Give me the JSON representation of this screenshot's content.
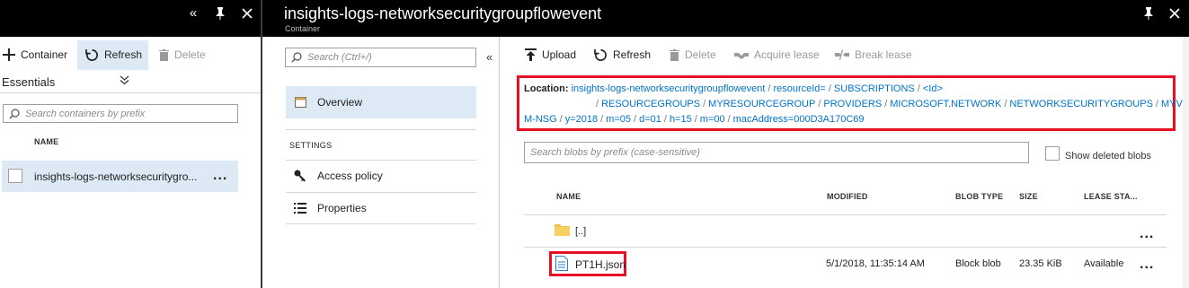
{
  "left_blade": {
    "toolbar": {
      "container_label": "Container",
      "refresh_label": "Refresh",
      "delete_label": "Delete"
    },
    "essentials_label": "Essentials",
    "search": {
      "placeholder": "Search containers by prefix"
    },
    "table": {
      "name_header": "NAME",
      "rows": [
        {
          "name": "insights-logs-networksecuritygro...",
          "more": "..."
        }
      ]
    }
  },
  "right_blade": {
    "title": "insights-logs-networksecuritygroupflowevent",
    "subtitle": "Container"
  },
  "menu": {
    "search": {
      "placeholder": "Search (Ctrl+/)"
    },
    "collapse_icon": "«",
    "overview_label": "Overview",
    "settings_header": "SETTINGS",
    "items": [
      {
        "label": "Access policy"
      },
      {
        "label": "Properties"
      }
    ]
  },
  "content": {
    "toolbar": {
      "upload_label": "Upload",
      "refresh_label": "Refresh",
      "delete_label": "Delete",
      "acquire_lease_label": "Acquire lease",
      "break_lease_label": "Break lease"
    },
    "location": {
      "label": "Location:",
      "line1": [
        "insights-logs-networksecuritygroupflowevent",
        "resourceId=",
        "SUBSCRIPTIONS",
        "<Id>"
      ],
      "line2": [
        "RESOURCEGROUPS",
        "MYRESOURCEGROUP",
        "PROVIDERS",
        "MICROSOFT.NETWORK",
        "NETWORKSECURITYGROUPS",
        "MYV"
      ],
      "line3": [
        "M-NSG",
        "y=2018",
        "m=05",
        "d=01",
        "h=15",
        "m=00",
        "macAddress=000D3A170C69"
      ]
    },
    "blob_search": {
      "placeholder": "Search blobs by prefix (case-sensitive)"
    },
    "show_deleted_label": "Show deleted blobs",
    "table": {
      "headers": {
        "name": "NAME",
        "modified": "MODIFIED",
        "blob_type": "BLOB TYPE",
        "size": "SIZE",
        "lease_state": "LEASE STA..."
      },
      "rows": [
        {
          "name": "[..]",
          "modified": "",
          "blob_type": "",
          "size": "",
          "lease_state": "",
          "more": "..."
        },
        {
          "name": "PT1H.json",
          "modified": "5/1/2018, 11:35:14 AM",
          "blob_type": "Block blob",
          "size": "23.35 KiB",
          "lease_state": "Available",
          "more": "..."
        }
      ]
    }
  },
  "colors": {
    "header_bg": "#000000",
    "selection_bg": "#dde9f5",
    "link": "#0072c6",
    "highlight_border": "#e81123",
    "folder": "#f2c14e",
    "file_icon": "#2f7dc8"
  }
}
